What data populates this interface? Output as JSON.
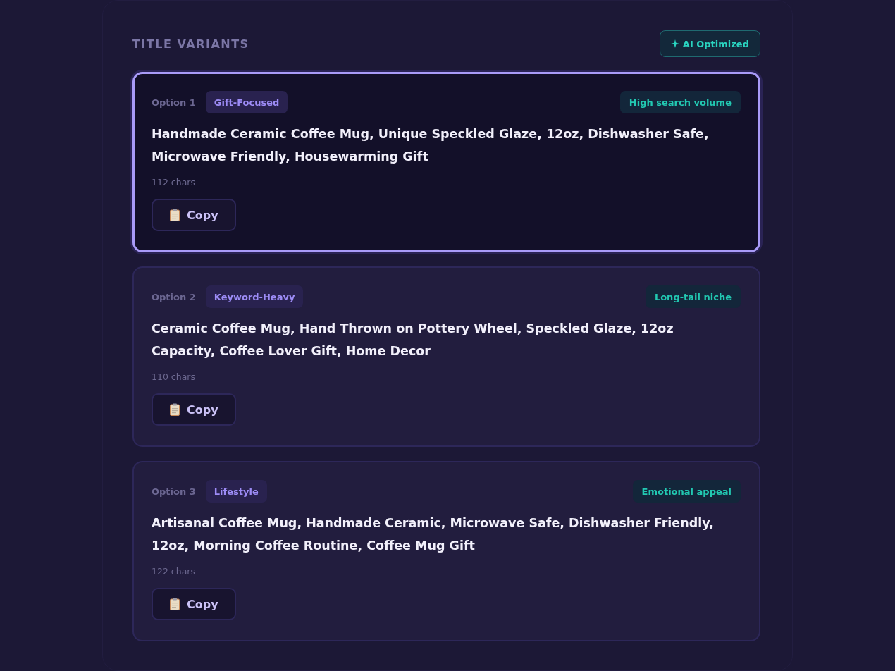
{
  "section": {
    "title": "TITLE VARIANTS",
    "badge": "AI Optimized"
  },
  "variants": [
    {
      "option": "Option 1",
      "tag": "Gift-Focused",
      "insight": "High search volume",
      "title": "Handmade Ceramic Coffee Mug, Unique Speckled Glaze, 12oz, Dishwasher Safe, Microwave Friendly, Housewarming Gift",
      "count": "112 chars",
      "button": "Copy",
      "selected": true
    },
    {
      "option": "Option 2",
      "tag": "Keyword-Heavy",
      "insight": "Long-tail niche",
      "title": "Ceramic Coffee Mug, Hand Thrown on Pottery Wheel, Speckled Glaze, 12oz Capacity, Coffee Lover Gift, Home Decor",
      "count": "110 chars",
      "button": "Copy",
      "selected": false
    },
    {
      "option": "Option 3",
      "tag": "Lifestyle",
      "insight": "Emotional appeal",
      "title": "Artisanal Coffee Mug, Handmade Ceramic, Microwave Safe, Dishwasher Friendly, 12oz, Morning Coffee Routine, Coffee Mug Gift",
      "count": "122 chars",
      "button": "Copy",
      "selected": false
    }
  ]
}
